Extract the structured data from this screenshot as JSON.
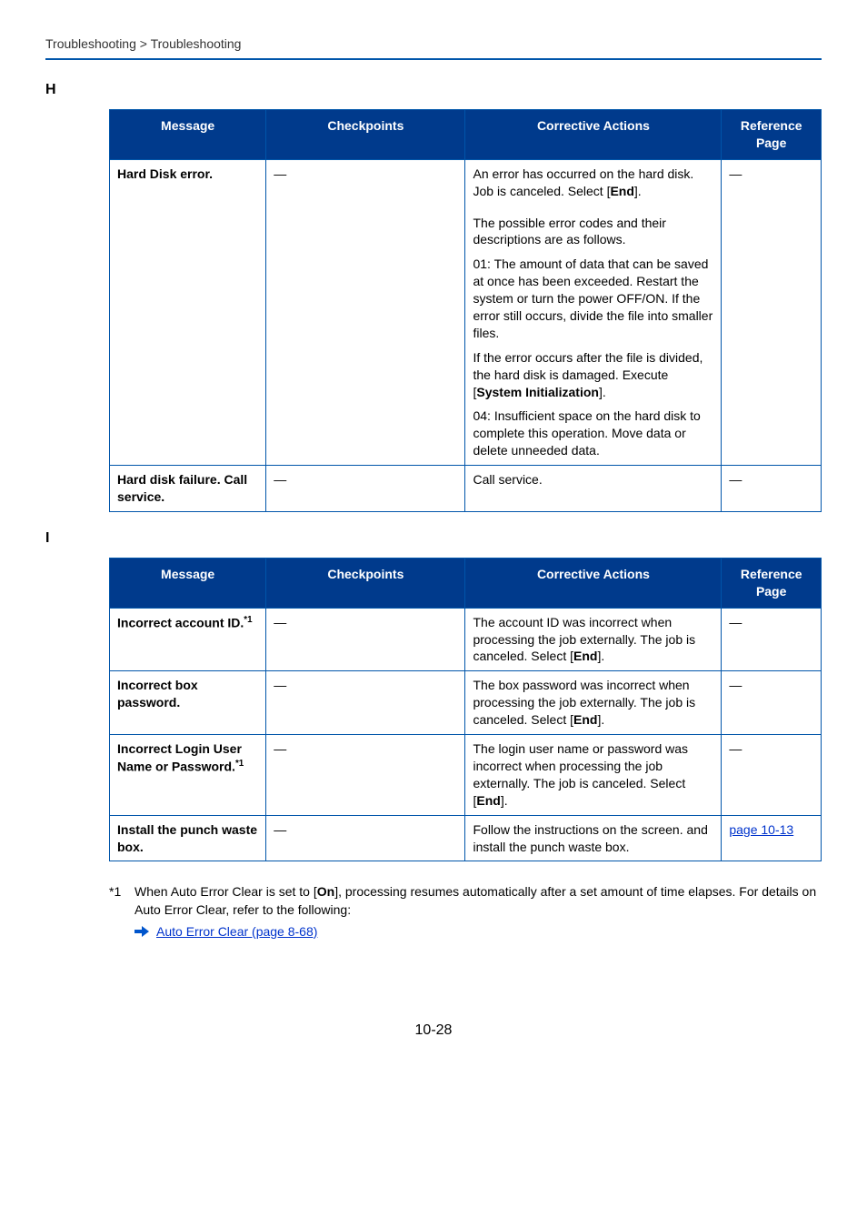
{
  "breadcrumb": "Troubleshooting > Troubleshooting",
  "headers": {
    "message": "Message",
    "checkpoints": "Checkpoints",
    "actions": "Corrective Actions",
    "ref": "Reference Page"
  },
  "sections": [
    {
      "letter": "H",
      "rows": [
        {
          "message": "Hard Disk error.",
          "checkpoints": "―",
          "actions": [
            "An error has occurred on the hard disk. Job is canceled. Select [<b>End</b>].",
            "The possible error codes and their descriptions are as follows.",
            "01: The amount of data that can be saved at once has been exceeded. Restart the system or turn the power OFF/ON. If the error still occurs, divide the file into smaller files.",
            "If the error occurs after the file is divided, the hard disk is damaged. Execute [<b>System Initialization</b>].",
            "04: Insufficient space on the hard disk to complete this operation. Move data or delete unneeded data."
          ],
          "ref": "―"
        },
        {
          "message": "Hard disk failure. Call service.",
          "checkpoints": "―",
          "actions": [
            "Call service."
          ],
          "ref": "―"
        }
      ]
    },
    {
      "letter": "I",
      "rows": [
        {
          "message": "Incorrect account ID.<sup>*1</sup>",
          "checkpoints": "―",
          "actions": [
            "The account ID was incorrect when processing the job externally. The job is canceled. Select [<b>End</b>]."
          ],
          "ref": "―"
        },
        {
          "message": "Incorrect box password.",
          "checkpoints": "―",
          "actions": [
            "The box password was incorrect when processing the job externally. The job is canceled. Select [<b>End</b>]."
          ],
          "ref": "―"
        },
        {
          "message": "Incorrect Login User Name or Password.<sup>*1</sup>",
          "checkpoints": "―",
          "actions": [
            "The login user name or password was incorrect when processing the job externally. The job is canceled. Select [<b>End</b>]."
          ],
          "ref": "―"
        },
        {
          "message": "Install the punch waste box.",
          "checkpoints": "―",
          "actions": [
            "Follow the instructions on the screen. and install the punch waste box."
          ],
          "ref_link": "page 10-13"
        }
      ]
    }
  ],
  "footnote": {
    "marker": "*1",
    "text": "When Auto Error Clear is set to [<b>On</b>], processing resumes automatically after a set amount of time elapses. For details on Auto Error Clear, refer to the following:",
    "link": "Auto Error Clear (page 8-68)"
  },
  "page_number": "10-28"
}
